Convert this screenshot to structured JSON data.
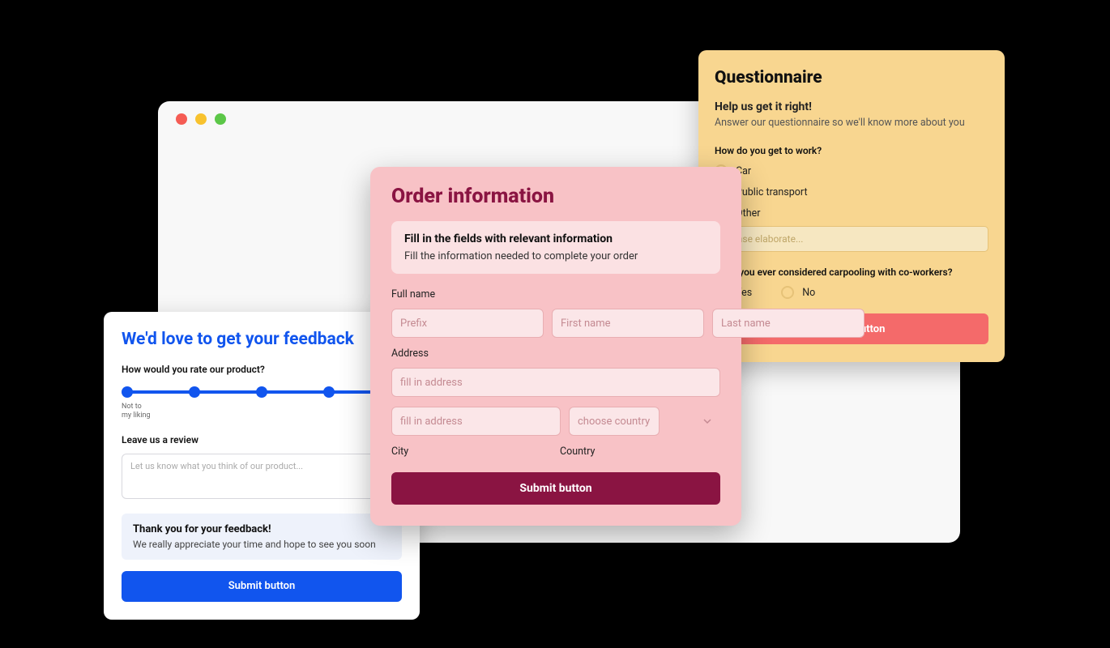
{
  "feedback": {
    "title": "We'd love to get your feedback",
    "question": "How would you rate our product?",
    "slider_low": "Not to\nmy liking",
    "review_label": "Leave us a review",
    "review_placeholder": "Let us know what you think of our product...",
    "thankyou_title": "Thank you for your feedback!",
    "thankyou_sub": "We really appreciate your time and hope to see you soon",
    "submit": "Submit button"
  },
  "order": {
    "title": "Order information",
    "box_title": "Fill in the fields with relevant information",
    "box_sub": "Fill the information needed to complete your order",
    "fullname_label": "Full name",
    "prefix_placeholder": "Prefix",
    "firstname_placeholder": "First name",
    "lastname_placeholder": "Last name",
    "address_label": "Address",
    "address1_placeholder": "fill in address",
    "address2_placeholder": "fill in address",
    "country_placeholder": "choose country",
    "city_label": "City",
    "country_label": "Country",
    "submit": "Submit button"
  },
  "quest": {
    "title": "Questionnaire",
    "subtitle": "Help us get it right!",
    "desc": "Answer our questionnaire so we'll know more about you",
    "q1": "How do you get to work?",
    "opt_car": "Car",
    "opt_transport": "Public transport",
    "opt_other": "Other",
    "elaborate_placeholder": "Please elaborate...",
    "q2": "Have you ever considered carpooling with co-workers?",
    "yes": "Yes",
    "no": "No",
    "submit": "Submit button"
  }
}
